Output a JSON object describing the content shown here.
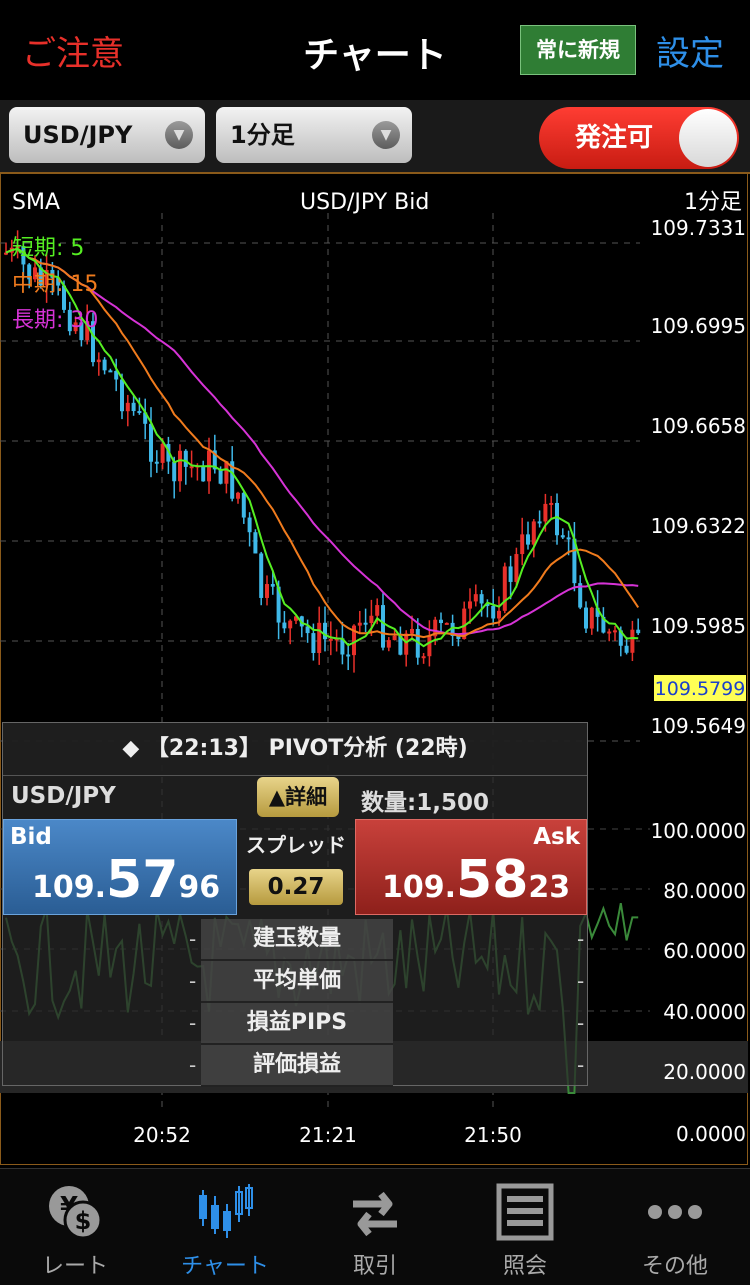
{
  "header": {
    "caution": "ご注意",
    "title": "チャート",
    "always_new": "常に新規",
    "settings": "設定"
  },
  "toolbar": {
    "pair": "USD/JPY",
    "timeframe": "1分足",
    "order_toggle": "発注可"
  },
  "chart": {
    "indicator": "SMA",
    "symbol": "USD/JPY  Bid",
    "timeframe": "1分足",
    "sma_short": "短期: 5",
    "sma_mid": "中期: 15",
    "sma_long": "長期: 30",
    "price_ticks": [
      "109.7331",
      "109.6995",
      "109.6658",
      "109.6322",
      "109.5985",
      "109.5649"
    ],
    "current_price": "109.5799",
    "osc_ticks": [
      "100.0000",
      "80.0000",
      "60.0000",
      "40.0000",
      "20.0000",
      "0.0000"
    ],
    "time_ticks": [
      "20:52",
      "21:21",
      "21:50"
    ],
    "colors": {
      "up": "#e8302a",
      "down": "#3fb8e8",
      "short": "#55ee22",
      "mid": "#f07b1d",
      "long": "#d633d6",
      "osc": "#3a8a3a"
    }
  },
  "panel": {
    "heading": "◆ 【22:13】 PIVOT分析 (22時)",
    "pair": "USD/JPY",
    "detail": "▲詳細",
    "quantity": "数量:1,500",
    "bid_label": "Bid",
    "bid_a": "109.",
    "bid_b": "57",
    "bid_c": "96",
    "spread_label": "スプレッド",
    "spread": "0.27",
    "ask_label": "Ask",
    "ask_a": "109.",
    "ask_b": "58",
    "ask_c": "23",
    "rows": [
      "建玉数量",
      "平均単価",
      "損益PIPS",
      "評価損益"
    ],
    "dash": "-"
  },
  "tabs": [
    {
      "label": "レート",
      "icon": "yen-dollar-icon"
    },
    {
      "label": "チャート",
      "icon": "candlestick-icon"
    },
    {
      "label": "取引",
      "icon": "exchange-arrows-icon"
    },
    {
      "label": "照会",
      "icon": "list-icon"
    },
    {
      "label": "その他",
      "icon": "more-dots-icon"
    }
  ]
}
